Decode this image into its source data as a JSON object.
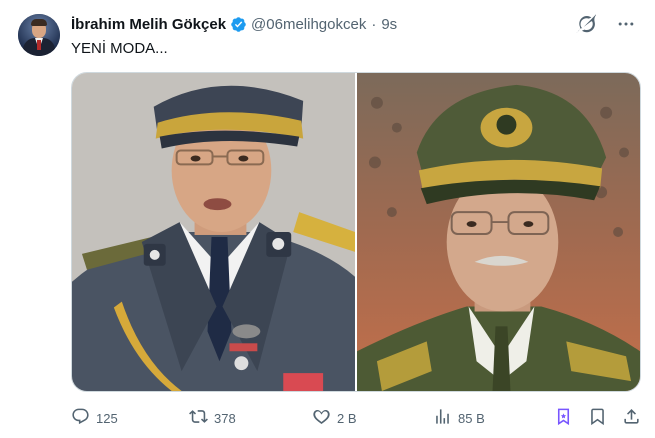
{
  "tweet": {
    "author_name": "İbrahim Melih Gökçek",
    "handle": "@06melihgokcek",
    "separator": "·",
    "time": "9s",
    "text": "YENİ MODA..."
  },
  "icons": {
    "verified": "verified-badge-icon",
    "grok": "grok-icon",
    "more": "more-icon",
    "reply": "reply-icon",
    "retweet": "retweet-icon",
    "like": "heart-icon",
    "views": "views-icon",
    "grok_action": "grok-action-icon",
    "bookmark": "bookmark-icon",
    "share": "share-icon"
  },
  "stats": {
    "replies": "125",
    "retweets": "378",
    "likes": "2 B",
    "views": "85 B"
  },
  "colors": {
    "verified": "#1d9bf0",
    "muted": "#536471",
    "grok_accent": "#7856ff"
  }
}
